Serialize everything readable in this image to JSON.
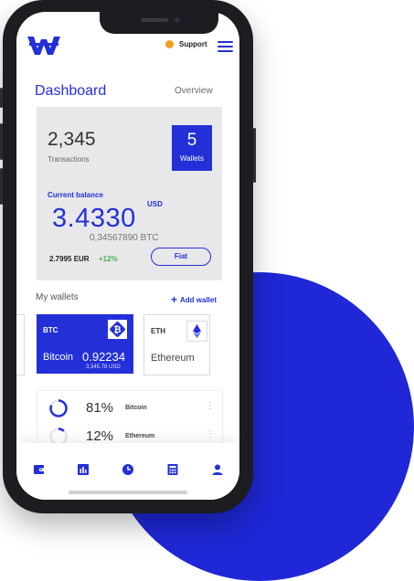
{
  "header": {
    "logo_letter": "W",
    "support_label": "Support"
  },
  "dashboard": {
    "title": "Dashboard",
    "overview_link": "Overview"
  },
  "summary": {
    "transactions_value": "2,345",
    "transactions_label": "Transactions",
    "wallets_value": "5",
    "wallets_label": "Wallets",
    "current_balance_label": "Current balance",
    "balance_value": "3.4330",
    "balance_currency": "USD",
    "btc_value": "0,34567890  BTC",
    "eur_value": "2.7995  EUR",
    "change": "+12%",
    "fiat_button": "Fiat"
  },
  "wallets": {
    "section_title": "My wallets",
    "add_wallet_label": "Add wallet",
    "items": [
      {
        "symbol": "BTC",
        "name": "Bitcoin",
        "value": "0.92234",
        "sub_value": "3,345.78  USD",
        "icon": "bitcoin-icon",
        "selected": true
      },
      {
        "symbol": "ETH",
        "name": "Ethereum",
        "icon": "ethereum-icon",
        "selected": false
      }
    ]
  },
  "allocation": [
    {
      "percent": "81%",
      "name": "Bitcoin",
      "share": 0.81
    },
    {
      "percent": "12%",
      "name": "Ethereum",
      "share": 0.12
    }
  ],
  "bottom_nav": [
    "wallet-icon",
    "chart-icon",
    "clock-icon",
    "calculator-icon",
    "user-icon"
  ],
  "colors": {
    "brand": "#2330d8",
    "support_dot": "#f29f1f",
    "positive": "#4caf50",
    "card_bg": "#e8e7ea",
    "blob": "#1f27d6"
  }
}
